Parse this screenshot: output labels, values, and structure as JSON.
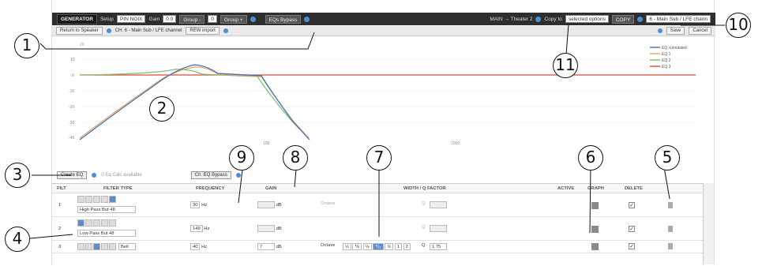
{
  "topbar": {
    "generator": "GENERATOR",
    "setup": "Setup",
    "preset": "PIN NOIX",
    "gain_label": "Gain",
    "gain_value": "0.0",
    "group_minus": "Group -",
    "group_value": "0",
    "group_plus": "Group +",
    "eq_bypass": "EQs Bypass",
    "route": "MAIN → Theater 2",
    "copy_to": "Copy to",
    "copy_options": "selected options",
    "copy_button": "COPY",
    "channel_select": "6 - Main Sub / LFE chann"
  },
  "subbar": {
    "return": "Return to Speaker",
    "channel": "CH. 6 - Main Sub / LFE channel",
    "rew_import": "REW import",
    "save": "Save",
    "cancel": "Cancel"
  },
  "legend": [
    {
      "label": "EQ cumulated",
      "color": "#3b6fc4"
    },
    {
      "label": "EQ 1",
      "color": "#f2a25c"
    },
    {
      "label": "EQ 2",
      "color": "#7cbf6a"
    },
    {
      "label": "EQ 3",
      "color": "#e0483a"
    }
  ],
  "graph": {
    "y_ticks": [
      "10",
      "0",
      "-10",
      "-20",
      "-30",
      "-40"
    ],
    "x_ticks": [
      "100",
      "1000"
    ],
    "top_tick": "20"
  },
  "controls": {
    "create": "Create EQ",
    "info": "0 Eq Calc available",
    "ch_bypass": "Ch. EQ Bypass"
  },
  "table": {
    "headers": {
      "filt": "FILT",
      "filter_type": "FILTER TYPE",
      "frequency": "FREQUENCY",
      "gain": "GAIN",
      "width": "WIDTH / Q FACTOR",
      "active": "ACTIVE",
      "graph": "GRAPH",
      "delete": "DELETE"
    },
    "rows": [
      {
        "num": "1",
        "type": "High Pass But 48",
        "freq": "30",
        "unit": "Hz",
        "gain": "",
        "db": "dB",
        "q_label": "Q",
        "q": ""
      },
      {
        "num": "2",
        "type": "Low Pass But 48",
        "freq": "149",
        "unit": "Hz",
        "gain": "",
        "db": "dB",
        "q_label": "Q",
        "q": ""
      },
      {
        "num": "3",
        "type": "Bell",
        "freq": "40",
        "unit": "Hz",
        "gain": "7",
        "db": "dB",
        "q_label": "Q",
        "q": "1.75"
      }
    ],
    "octave": "Octave",
    "octave_options": [
      "⅓",
      "⅙",
      "⅛",
      "⅟₁₂",
      "½",
      "1",
      "2"
    ]
  },
  "callouts": [
    "1",
    "2",
    "3",
    "4",
    "5",
    "6",
    "7",
    "8",
    "9",
    "10",
    "11"
  ]
}
